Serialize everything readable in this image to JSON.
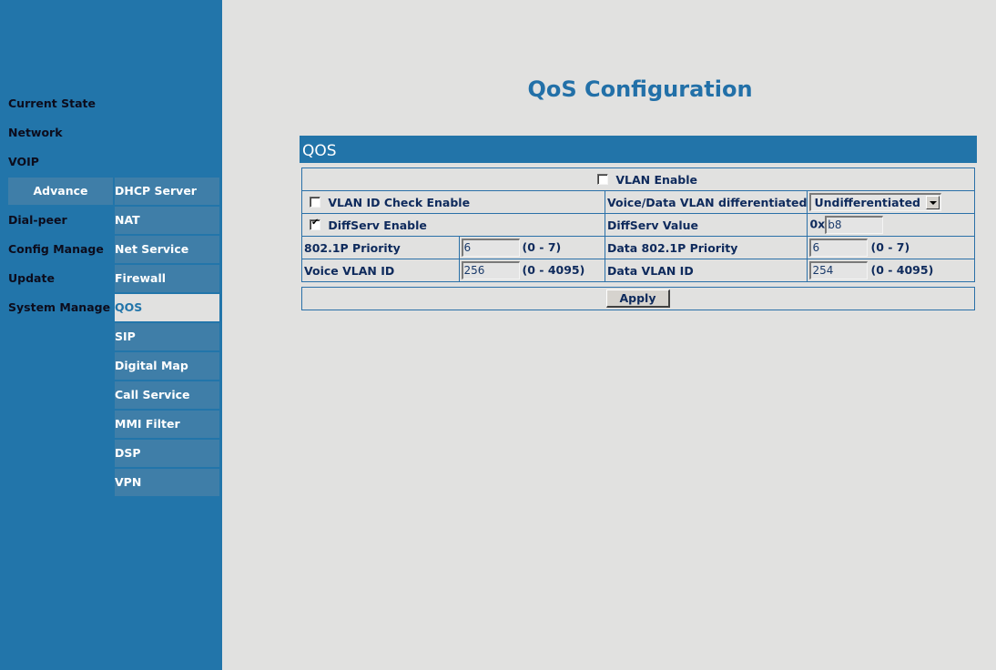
{
  "sidebar": {
    "main_items": [
      {
        "label": "Current State",
        "active": false
      },
      {
        "label": "Network",
        "active": false
      },
      {
        "label": "VOIP",
        "active": false
      },
      {
        "label": "Advance",
        "active": true
      },
      {
        "label": "Dial-peer",
        "active": false
      },
      {
        "label": "Config Manage",
        "active": false
      },
      {
        "label": "Update",
        "active": false
      },
      {
        "label": "System Manage",
        "active": false
      }
    ],
    "sub_items": [
      {
        "label": "DHCP Server",
        "active": false
      },
      {
        "label": "NAT",
        "active": false
      },
      {
        "label": "Net Service",
        "active": false
      },
      {
        "label": "Firewall",
        "active": false
      },
      {
        "label": "QOS",
        "active": true
      },
      {
        "label": "SIP",
        "active": false
      },
      {
        "label": "Digital Map",
        "active": false
      },
      {
        "label": "Call Service",
        "active": false
      },
      {
        "label": "MMI Filter",
        "active": false
      },
      {
        "label": "DSP",
        "active": false
      },
      {
        "label": "VPN",
        "active": false
      }
    ]
  },
  "page": {
    "title": "QoS Configuration",
    "section_title": "QOS"
  },
  "form": {
    "vlan_enable": {
      "label": "VLAN Enable",
      "checked": false
    },
    "vlan_id_check": {
      "label": "VLAN ID Check Enable",
      "checked": false
    },
    "voice_data_diff": {
      "label": "Voice/Data VLAN differentiated",
      "value": "Undifferentiated"
    },
    "diffserv_enable": {
      "label": "DiffServ Enable",
      "checked": true
    },
    "diffserv_value": {
      "label": "DiffServ Value",
      "prefix": "0x",
      "value": "b8"
    },
    "priority_8021p": {
      "label": "802.1P Priority",
      "value": "6",
      "range": "(0 - 7)"
    },
    "data_priority_8021p": {
      "label": "Data 802.1P Priority",
      "value": "6",
      "range": "(0 - 7)"
    },
    "voice_vlan_id": {
      "label": "Voice VLAN ID",
      "value": "256",
      "range": "(0 - 4095)"
    },
    "data_vlan_id": {
      "label": "Data VLAN ID",
      "value": "254",
      "range": "(0 - 4095)"
    }
  },
  "actions": {
    "apply_label": "Apply"
  },
  "colors": {
    "sidebar_bg": "#2275aa",
    "sidebar_item_bg": "#3f7ea8",
    "page_bg": "#e1e1e0",
    "accent": "#2270a8",
    "text_dark": "#0e2a5c"
  }
}
